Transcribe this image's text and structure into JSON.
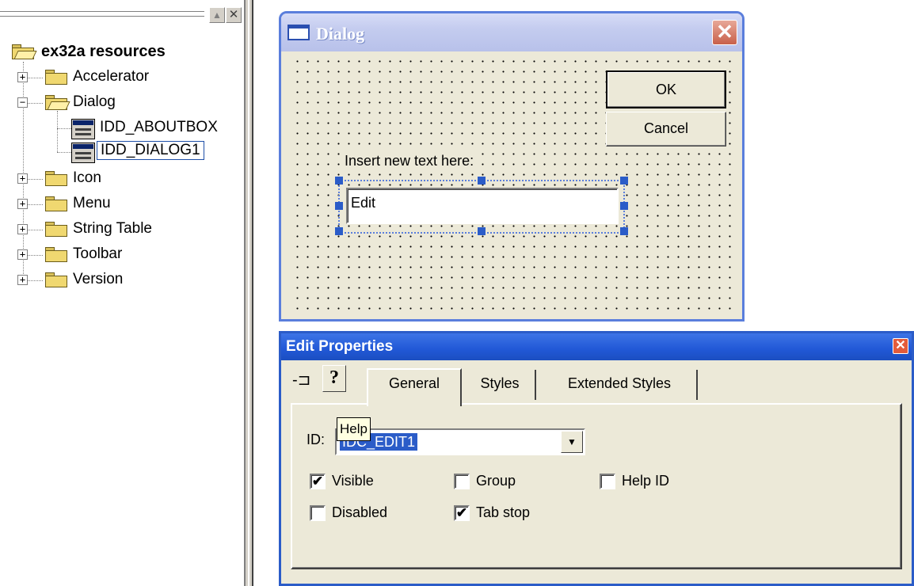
{
  "tree": {
    "root": "ex32a resources",
    "items": [
      {
        "label": "Accelerator",
        "expander": "+"
      },
      {
        "label": "Dialog",
        "expander": "−"
      },
      {
        "label": "IDD_ABOUTBOX"
      },
      {
        "label": "IDD_DIALOG1",
        "selected": true
      },
      {
        "label": "Icon",
        "expander": "+"
      },
      {
        "label": "Menu",
        "expander": "+"
      },
      {
        "label": "String Table",
        "expander": "+"
      },
      {
        "label": "Toolbar",
        "expander": "+"
      },
      {
        "label": "Version",
        "expander": "+"
      }
    ],
    "restore_glyph": "▲",
    "close_glyph": "✕"
  },
  "dialog": {
    "title": "Dialog",
    "close_glyph": "✕",
    "ok_label": "OK",
    "cancel_label": "Cancel",
    "static_text": "Insert new text here:",
    "edit_text": "Edit"
  },
  "properties": {
    "title": "Edit Properties",
    "close_glyph": "✕",
    "pin_glyph": "-⊐",
    "help_glyph": "?",
    "tabs": [
      "General",
      "Styles",
      "Extended Styles"
    ],
    "id_label": "ID:",
    "id_value": "IDC_EDIT1",
    "combo_arrow": "▼",
    "tooltip": "Help",
    "check_mark": "✔",
    "checkboxes": [
      {
        "label": "Visible",
        "checked": true
      },
      {
        "label": "Group",
        "checked": false
      },
      {
        "label": "Help ID",
        "checked": false
      },
      {
        "label": "Disabled",
        "checked": false
      },
      {
        "label": "Tab stop",
        "checked": true
      }
    ]
  },
  "colors": {
    "xp_blue": "#2b5cc8",
    "face": "#ece9d8",
    "selection_handle": "#2b5cc8"
  }
}
